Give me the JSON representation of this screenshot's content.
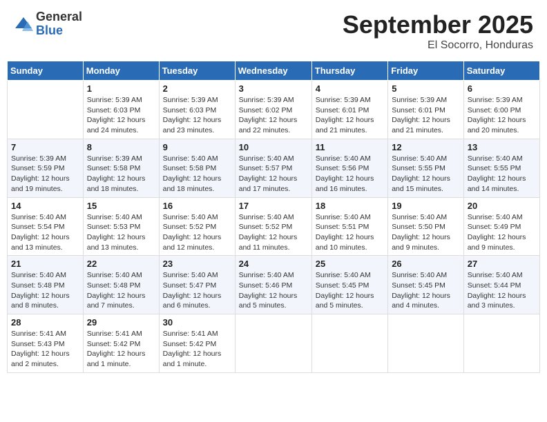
{
  "header": {
    "logo_general": "General",
    "logo_blue": "Blue",
    "month_title": "September 2025",
    "location": "El Socorro, Honduras"
  },
  "weekdays": [
    "Sunday",
    "Monday",
    "Tuesday",
    "Wednesday",
    "Thursday",
    "Friday",
    "Saturday"
  ],
  "weeks": [
    [
      {
        "day": "",
        "info": ""
      },
      {
        "day": "1",
        "info": "Sunrise: 5:39 AM\nSunset: 6:03 PM\nDaylight: 12 hours\nand 24 minutes."
      },
      {
        "day": "2",
        "info": "Sunrise: 5:39 AM\nSunset: 6:03 PM\nDaylight: 12 hours\nand 23 minutes."
      },
      {
        "day": "3",
        "info": "Sunrise: 5:39 AM\nSunset: 6:02 PM\nDaylight: 12 hours\nand 22 minutes."
      },
      {
        "day": "4",
        "info": "Sunrise: 5:39 AM\nSunset: 6:01 PM\nDaylight: 12 hours\nand 21 minutes."
      },
      {
        "day": "5",
        "info": "Sunrise: 5:39 AM\nSunset: 6:01 PM\nDaylight: 12 hours\nand 21 minutes."
      },
      {
        "day": "6",
        "info": "Sunrise: 5:39 AM\nSunset: 6:00 PM\nDaylight: 12 hours\nand 20 minutes."
      }
    ],
    [
      {
        "day": "7",
        "info": "Sunrise: 5:39 AM\nSunset: 5:59 PM\nDaylight: 12 hours\nand 19 minutes."
      },
      {
        "day": "8",
        "info": "Sunrise: 5:39 AM\nSunset: 5:58 PM\nDaylight: 12 hours\nand 18 minutes."
      },
      {
        "day": "9",
        "info": "Sunrise: 5:40 AM\nSunset: 5:58 PM\nDaylight: 12 hours\nand 18 minutes."
      },
      {
        "day": "10",
        "info": "Sunrise: 5:40 AM\nSunset: 5:57 PM\nDaylight: 12 hours\nand 17 minutes."
      },
      {
        "day": "11",
        "info": "Sunrise: 5:40 AM\nSunset: 5:56 PM\nDaylight: 12 hours\nand 16 minutes."
      },
      {
        "day": "12",
        "info": "Sunrise: 5:40 AM\nSunset: 5:55 PM\nDaylight: 12 hours\nand 15 minutes."
      },
      {
        "day": "13",
        "info": "Sunrise: 5:40 AM\nSunset: 5:55 PM\nDaylight: 12 hours\nand 14 minutes."
      }
    ],
    [
      {
        "day": "14",
        "info": "Sunrise: 5:40 AM\nSunset: 5:54 PM\nDaylight: 12 hours\nand 13 minutes."
      },
      {
        "day": "15",
        "info": "Sunrise: 5:40 AM\nSunset: 5:53 PM\nDaylight: 12 hours\nand 13 minutes."
      },
      {
        "day": "16",
        "info": "Sunrise: 5:40 AM\nSunset: 5:52 PM\nDaylight: 12 hours\nand 12 minutes."
      },
      {
        "day": "17",
        "info": "Sunrise: 5:40 AM\nSunset: 5:52 PM\nDaylight: 12 hours\nand 11 minutes."
      },
      {
        "day": "18",
        "info": "Sunrise: 5:40 AM\nSunset: 5:51 PM\nDaylight: 12 hours\nand 10 minutes."
      },
      {
        "day": "19",
        "info": "Sunrise: 5:40 AM\nSunset: 5:50 PM\nDaylight: 12 hours\nand 9 minutes."
      },
      {
        "day": "20",
        "info": "Sunrise: 5:40 AM\nSunset: 5:49 PM\nDaylight: 12 hours\nand 9 minutes."
      }
    ],
    [
      {
        "day": "21",
        "info": "Sunrise: 5:40 AM\nSunset: 5:48 PM\nDaylight: 12 hours\nand 8 minutes."
      },
      {
        "day": "22",
        "info": "Sunrise: 5:40 AM\nSunset: 5:48 PM\nDaylight: 12 hours\nand 7 minutes."
      },
      {
        "day": "23",
        "info": "Sunrise: 5:40 AM\nSunset: 5:47 PM\nDaylight: 12 hours\nand 6 minutes."
      },
      {
        "day": "24",
        "info": "Sunrise: 5:40 AM\nSunset: 5:46 PM\nDaylight: 12 hours\nand 5 minutes."
      },
      {
        "day": "25",
        "info": "Sunrise: 5:40 AM\nSunset: 5:45 PM\nDaylight: 12 hours\nand 5 minutes."
      },
      {
        "day": "26",
        "info": "Sunrise: 5:40 AM\nSunset: 5:45 PM\nDaylight: 12 hours\nand 4 minutes."
      },
      {
        "day": "27",
        "info": "Sunrise: 5:40 AM\nSunset: 5:44 PM\nDaylight: 12 hours\nand 3 minutes."
      }
    ],
    [
      {
        "day": "28",
        "info": "Sunrise: 5:41 AM\nSunset: 5:43 PM\nDaylight: 12 hours\nand 2 minutes."
      },
      {
        "day": "29",
        "info": "Sunrise: 5:41 AM\nSunset: 5:42 PM\nDaylight: 12 hours\nand 1 minute."
      },
      {
        "day": "30",
        "info": "Sunrise: 5:41 AM\nSunset: 5:42 PM\nDaylight: 12 hours\nand 1 minute."
      },
      {
        "day": "",
        "info": ""
      },
      {
        "day": "",
        "info": ""
      },
      {
        "day": "",
        "info": ""
      },
      {
        "day": "",
        "info": ""
      }
    ]
  ]
}
